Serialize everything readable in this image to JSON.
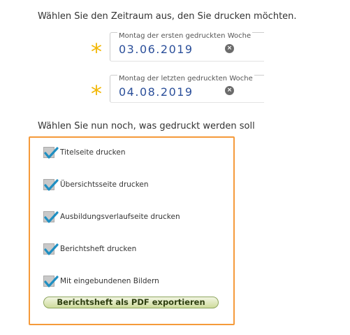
{
  "intro_text": "Wählen Sie den Zeitraum aus, den Sie drucken möchten.",
  "start_date": {
    "label": "Montag der ersten gedruckten Woche",
    "value": "03.06.2019"
  },
  "end_date": {
    "label": "Montag der letzten gedruckten Woche",
    "value": "04.08.2019"
  },
  "required_marker": "*",
  "clear_glyph": "×",
  "options_heading": "Wählen Sie nun noch, was gedruckt werden soll",
  "options": [
    {
      "label": "Titelseite drucken",
      "checked": true
    },
    {
      "label": "Übersichtsseite drucken",
      "checked": true
    },
    {
      "label": "Ausbildungsverlaufseite drucken",
      "checked": true
    },
    {
      "label": "Berichtsheft drucken",
      "checked": true
    },
    {
      "label": "Mit eingebundenen Bildern",
      "checked": true
    }
  ],
  "export_button_label": "Berichtsheft als PDF exportieren",
  "colors": {
    "accent_border": "#f59a3a",
    "required_star": "#f2b705",
    "date_text": "#2b4f9a",
    "checkmark": "#1f8fc2",
    "button_green": "#cfdc9d"
  },
  "icons": {
    "checkbox": "checkmark-icon",
    "clear": "clear-icon",
    "required": "asterisk-icon"
  }
}
